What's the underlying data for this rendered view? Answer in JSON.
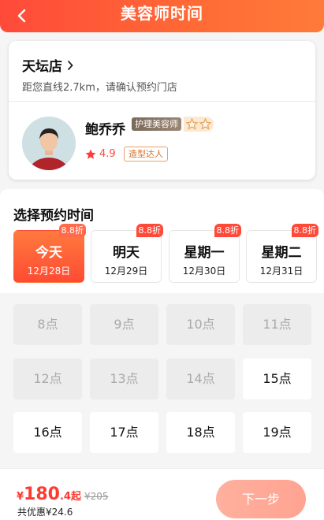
{
  "header": {
    "title": "美容师时间",
    "back_icon": "chevron-left-icon"
  },
  "store": {
    "name": "天坛店",
    "hint": "距您直线2.7km，请确认预约门店"
  },
  "beautician": {
    "name": "鲍乔乔",
    "role": "护理美容师",
    "level_stars": 2,
    "rating": "4.9",
    "tag": "造型达人"
  },
  "date_section": {
    "title": "选择预约时间",
    "tabs": [
      {
        "day": "今天",
        "date": "12月28日",
        "discount": "8.8折",
        "active": true
      },
      {
        "day": "明天",
        "date": "12月29日",
        "discount": "8.8折",
        "active": false
      },
      {
        "day": "星期一",
        "date": "12月30日",
        "discount": "8.8折",
        "active": false
      },
      {
        "day": "星期二",
        "date": "12月31日",
        "discount": "8.8折",
        "active": false
      }
    ]
  },
  "hours": [
    {
      "label": "8点",
      "available": false
    },
    {
      "label": "9点",
      "available": false
    },
    {
      "label": "10点",
      "available": false
    },
    {
      "label": "11点",
      "available": false
    },
    {
      "label": "12点",
      "available": false
    },
    {
      "label": "13点",
      "available": false
    },
    {
      "label": "14点",
      "available": false
    },
    {
      "label": "15点",
      "available": true
    },
    {
      "label": "16点",
      "available": true
    },
    {
      "label": "17点",
      "available": true
    },
    {
      "label": "18点",
      "available": true
    },
    {
      "label": "19点",
      "available": true
    }
  ],
  "bottom": {
    "currency": "¥",
    "price_int": "180",
    "price_dec": ".4",
    "price_suffix": "起",
    "original_price": "¥205",
    "saving": "共优惠¥24.6",
    "next_label": "下一步"
  },
  "colors": {
    "accent": "#ff4a3a",
    "accent_light": "#ffa391",
    "star": "#ff3b3b"
  }
}
